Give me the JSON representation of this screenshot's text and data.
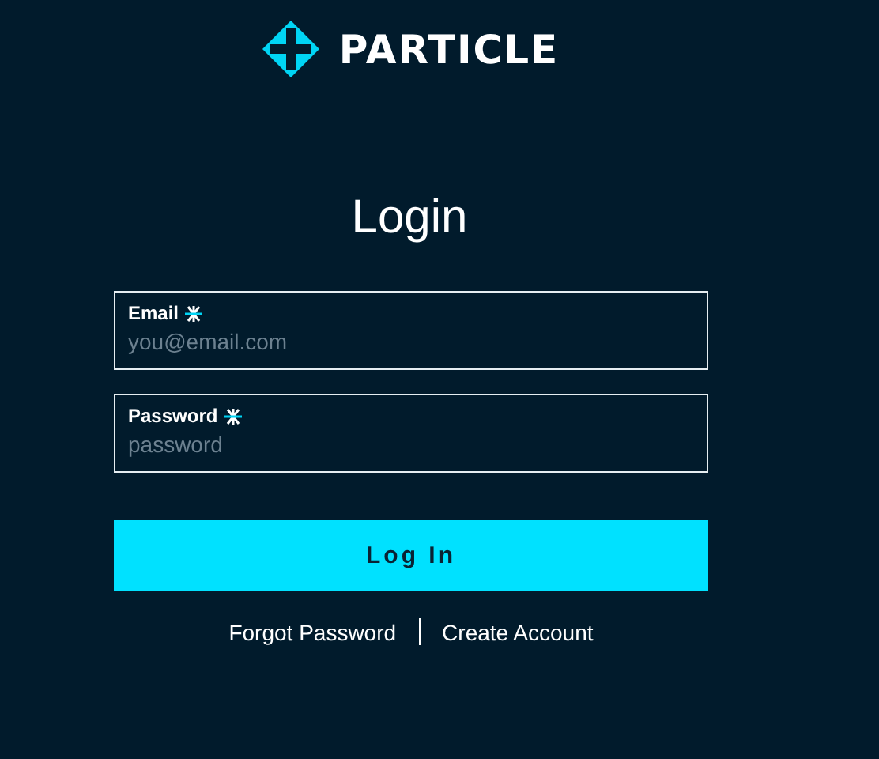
{
  "logo": {
    "text": "PARTICLE"
  },
  "title": "Login",
  "fields": [
    {
      "label": "Email",
      "required": true,
      "placeholder": "you@email.com"
    },
    {
      "label": "Password",
      "required": true,
      "placeholder": "password"
    }
  ],
  "submit": "Log In",
  "links": [
    "Forgot Password",
    "Create Account"
  ]
}
